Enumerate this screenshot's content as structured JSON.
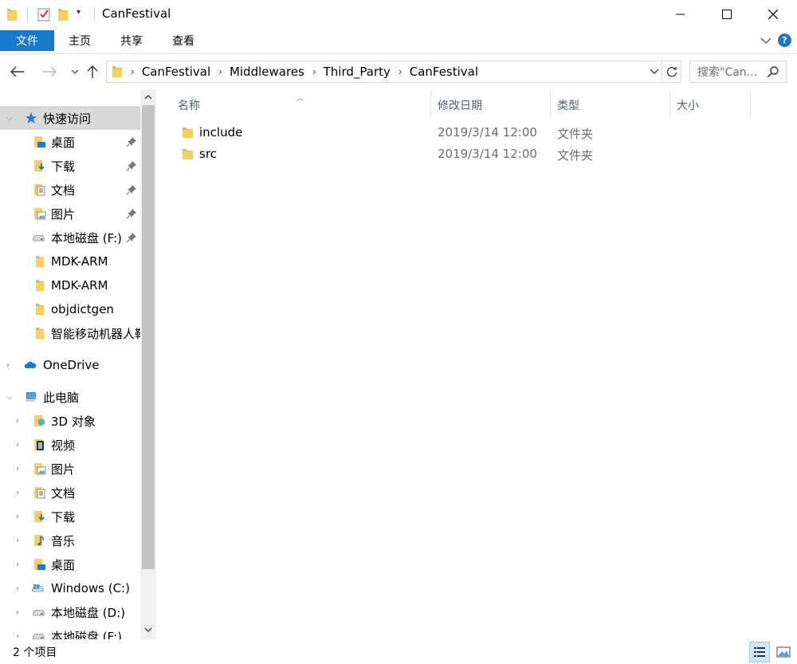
{
  "window": {
    "title": "CanFestival",
    "minimize_icon": "minimize-icon",
    "maximize_icon": "maximize-icon",
    "close_icon": "close-icon"
  },
  "ribbon": {
    "file_tab": "文件",
    "tabs": [
      "主页",
      "共享",
      "查看"
    ],
    "help": "?"
  },
  "address": {
    "breadcrumbs": [
      "CanFestival",
      "Middlewares",
      "Third_Party",
      "CanFestival"
    ],
    "search_placeholder": "搜索\"Can..."
  },
  "nav": {
    "quick_access": "快速访问",
    "quick_items": [
      {
        "label": "桌面",
        "icon": "desktop-icon",
        "pinned": true
      },
      {
        "label": "下载",
        "icon": "download-icon",
        "pinned": true
      },
      {
        "label": "文档",
        "icon": "documents-icon",
        "pinned": true
      },
      {
        "label": "图片",
        "icon": "pictures-icon",
        "pinned": true
      },
      {
        "label": "本地磁盘 (F:)",
        "icon": "drive-icon",
        "pinned": true
      },
      {
        "label": "MDK-ARM",
        "icon": "folder-icon",
        "pinned": false
      },
      {
        "label": "MDK-ARM",
        "icon": "folder-icon",
        "pinned": false
      },
      {
        "label": "objdictgen",
        "icon": "folder-icon",
        "pinned": false
      },
      {
        "label": "智能移动机器人鞘",
        "icon": "folder-icon",
        "pinned": false
      }
    ],
    "onedrive": "OneDrive",
    "this_pc": "此电脑",
    "pc_items": [
      {
        "label": "3D 对象",
        "icon": "3d-objects-icon"
      },
      {
        "label": "视频",
        "icon": "videos-icon"
      },
      {
        "label": "图片",
        "icon": "pictures-icon"
      },
      {
        "label": "文档",
        "icon": "documents-icon"
      },
      {
        "label": "下载",
        "icon": "download-icon"
      },
      {
        "label": "音乐",
        "icon": "music-icon"
      },
      {
        "label": "桌面",
        "icon": "desktop-icon"
      },
      {
        "label": "Windows (C:)",
        "icon": "windows-drive-icon"
      },
      {
        "label": "本地磁盘 (D:)",
        "icon": "drive-icon"
      },
      {
        "label": "本地磁盘 (F:)",
        "icon": "drive-icon"
      }
    ]
  },
  "columns": {
    "name": "名称",
    "date": "修改日期",
    "type": "类型",
    "size": "大小"
  },
  "files": [
    {
      "name": "include",
      "date": "2019/3/14 12:00",
      "type": "文件夹",
      "icon": "folder-icon"
    },
    {
      "name": "src",
      "date": "2019/3/14 12:00",
      "type": "文件夹",
      "icon": "folder-icon"
    }
  ],
  "status": {
    "item_count": "2 个项目"
  },
  "colors": {
    "accent": "#1979ca",
    "selection": "#cce8ff",
    "folder": "#f4c542"
  }
}
